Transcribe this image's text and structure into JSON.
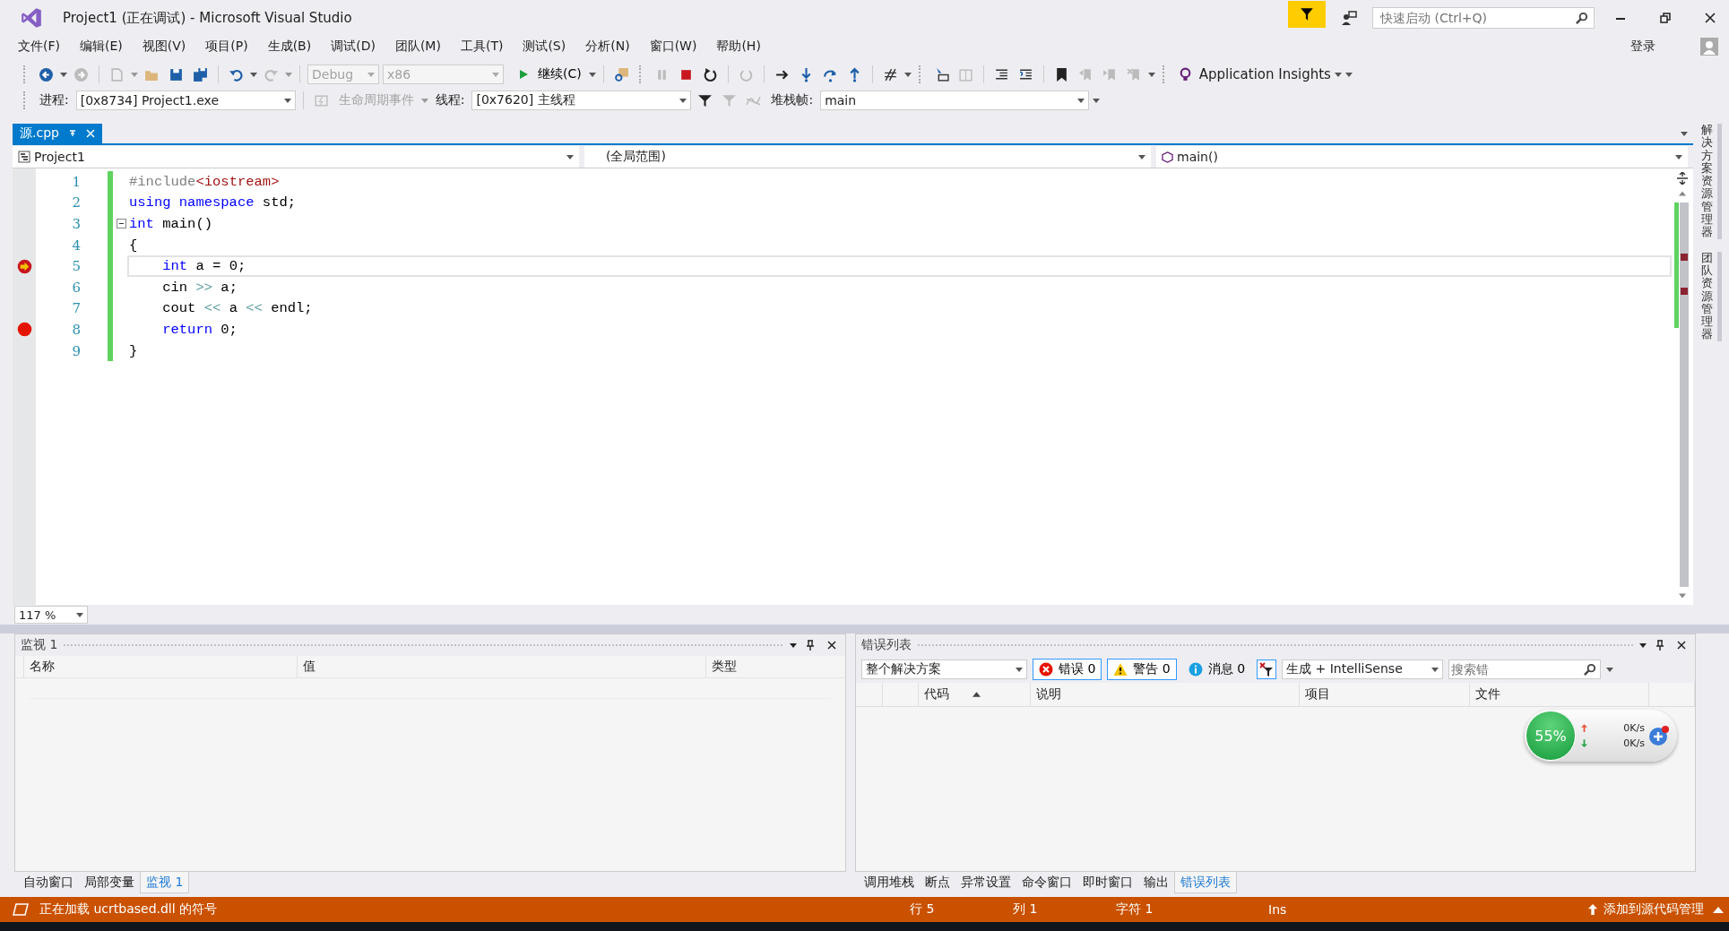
{
  "window": {
    "title": "Project1 (正在调试) - Microsoft Visual Studio"
  },
  "quick_launch": {
    "placeholder": "快速启动 (Ctrl+Q)"
  },
  "menu": [
    "文件(F)",
    "编辑(E)",
    "视图(V)",
    "项目(P)",
    "生成(B)",
    "调试(D)",
    "团队(M)",
    "工具(T)",
    "测试(S)",
    "分析(N)",
    "窗口(W)",
    "帮助(H)"
  ],
  "account": {
    "sign_in": "登录"
  },
  "toolbar": {
    "configuration": {
      "value": "Debug",
      "disabled": true
    },
    "platform": {
      "value": "x86",
      "disabled": true
    },
    "continue": "继续(C)",
    "insights": "Application Insights"
  },
  "debug_location": {
    "process_label": "进程:",
    "process": "[0x8734] Project1.exe",
    "lifecycle": {
      "label": "生命周期事件",
      "disabled": true
    },
    "thread_label": "线程:",
    "thread": "[0x7620] 主线程",
    "stack_label": "堆栈帧:",
    "stack": "main"
  },
  "document_tabs": [
    {
      "label": "源.cpp",
      "selected": true
    }
  ],
  "navigation": {
    "project": "Project1",
    "scope": "(全局范围)",
    "member": "main()"
  },
  "editor": {
    "zoom": "117 %",
    "lines": [
      {
        "number": "1",
        "tokens": [
          {
            "text": "#include",
            "kind": "pre"
          },
          {
            "text": "<iostream>",
            "kind": "str"
          }
        ]
      },
      {
        "number": "2",
        "tokens": [
          {
            "text": "using namespace",
            "kind": "kw"
          },
          {
            "text": " std;",
            "kind": "plain"
          }
        ]
      },
      {
        "number": "3",
        "fold": {
          "expanded": true
        },
        "tokens": [
          {
            "text": "int",
            "kind": "kw"
          },
          {
            "text": " main()",
            "kind": "plain"
          }
        ]
      },
      {
        "number": "4",
        "tokens": [
          {
            "text": "{",
            "kind": "plain"
          }
        ]
      },
      {
        "number": "5",
        "kind": "current_statement",
        "tokens": [
          {
            "text": "    int",
            "kind": "kw"
          },
          {
            "text": " a = 0;",
            "kind": "plain"
          }
        ]
      },
      {
        "number": "6",
        "tokens": [
          {
            "text": "    cin ",
            "kind": "plain"
          },
          {
            "text": ">>",
            "kind": "op"
          },
          {
            "text": " a;",
            "kind": "plain"
          }
        ]
      },
      {
        "number": "7",
        "tokens": [
          {
            "text": "    cout ",
            "kind": "plain"
          },
          {
            "text": "<<",
            "kind": "op"
          },
          {
            "text": " a ",
            "kind": "plain"
          },
          {
            "text": "<<",
            "kind": "op"
          },
          {
            "text": " endl;",
            "kind": "plain"
          }
        ]
      },
      {
        "number": "8",
        "kind": "breakpoint",
        "tokens": [
          {
            "text": "    return",
            "kind": "kw"
          },
          {
            "text": " 0;",
            "kind": "plain"
          }
        ]
      },
      {
        "number": "9",
        "tokens": [
          {
            "text": "}",
            "kind": "plain"
          }
        ]
      }
    ]
  },
  "side_tabs": [
    "解决方案资源管理器",
    "团队资源管理器"
  ],
  "watch_panel": {
    "title": "监视 1",
    "columns": [
      "名称",
      "值",
      "类型"
    ]
  },
  "left_tabs": [
    {
      "label": "自动窗口",
      "selected": false
    },
    {
      "label": "局部变量",
      "selected": false
    },
    {
      "label": "监视 1",
      "selected": true
    }
  ],
  "error_list": {
    "title": "错误列表",
    "scope": "整个解决方案",
    "filters": [
      {
        "kind": "error",
        "label": "错误 0",
        "selected": true
      },
      {
        "kind": "warning",
        "label": "警告 0",
        "selected": true
      },
      {
        "kind": "message",
        "label": "消息 0",
        "selected": false
      }
    ],
    "source": "生成 + IntelliSense",
    "search_placeholder": "搜索错",
    "columns": [
      "代码",
      "说明",
      "项目",
      "文件"
    ]
  },
  "right_tabs": [
    {
      "label": "调用堆栈",
      "selected": false
    },
    {
      "label": "断点",
      "selected": false
    },
    {
      "label": "异常设置",
      "selected": false
    },
    {
      "label": "命令窗口",
      "selected": false
    },
    {
      "label": "即时窗口",
      "selected": false
    },
    {
      "label": "输出",
      "selected": false
    },
    {
      "label": "错误列表",
      "selected": true
    }
  ],
  "speed_widget": {
    "percent": "55%",
    "upload": "0K/s",
    "download": "0K/s"
  },
  "status_bar": {
    "message": "正在加载 ucrtbased.dll 的符号",
    "line": "行 5",
    "column": "列 1",
    "char": "字符 1",
    "mode": "Ins",
    "source_control": "添加到源代码管理"
  }
}
